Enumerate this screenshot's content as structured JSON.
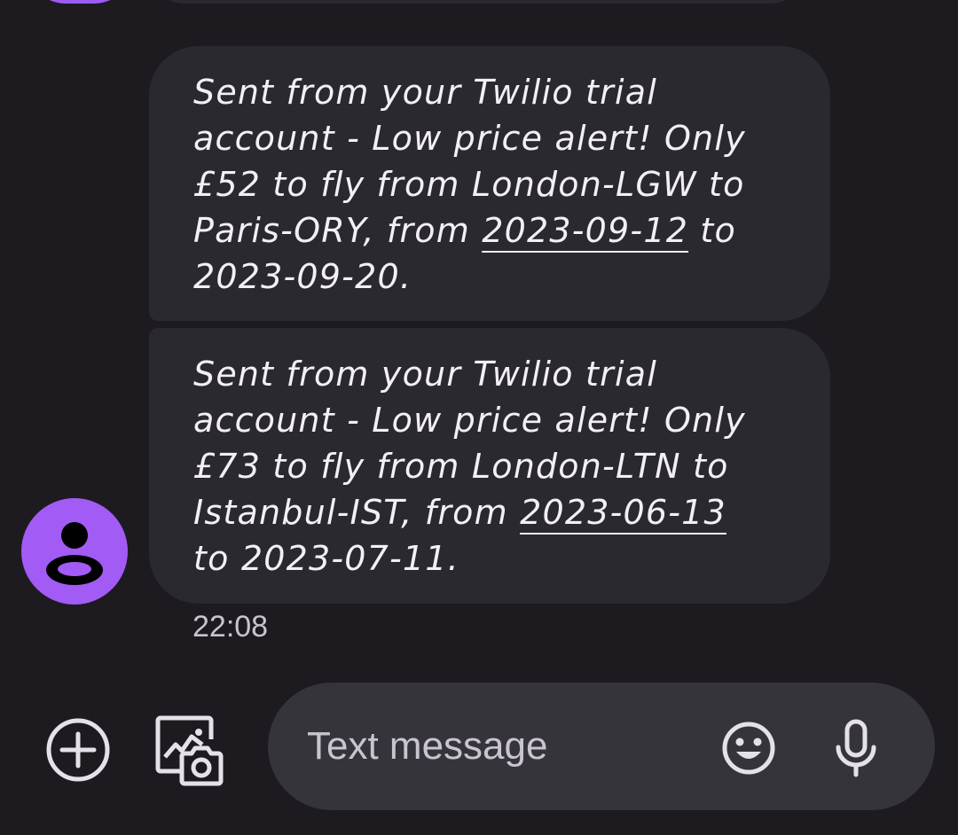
{
  "messages": [
    {
      "lines": [
        {
          "text": "Sent from your Twilio trial"
        },
        {
          "text": "account - Low price alert! Only"
        },
        {
          "text": "£52 to fly from London-LGW to"
        },
        {
          "pre": "Paris-ORY, from ",
          "link": "2023-09-12",
          "post": " to"
        },
        {
          "text": "2023-09-20."
        }
      ]
    },
    {
      "lines": [
        {
          "text": "Sent from your Twilio trial"
        },
        {
          "text": "account - Low price alert! Only"
        },
        {
          "text": "£73 to fly from London-LTN to"
        },
        {
          "pre": "Istanbul-IST, from ",
          "link": "2023-06-13",
          "post": ""
        },
        {
          "text": "to 2023-07-11."
        }
      ]
    }
  ],
  "timestamp": "22:08",
  "composer": {
    "placeholder": "Text message",
    "icons": {
      "add": "plus-circle-icon",
      "media": "gallery-camera-icon",
      "emoji": "smiley-face-icon",
      "mic": "microphone-icon"
    }
  },
  "colors": {
    "background": "#1d1b20",
    "bubble": "#2b2930",
    "avatar": "#a35bf5",
    "input_field": "#36343b",
    "text": "#f4eff6"
  }
}
